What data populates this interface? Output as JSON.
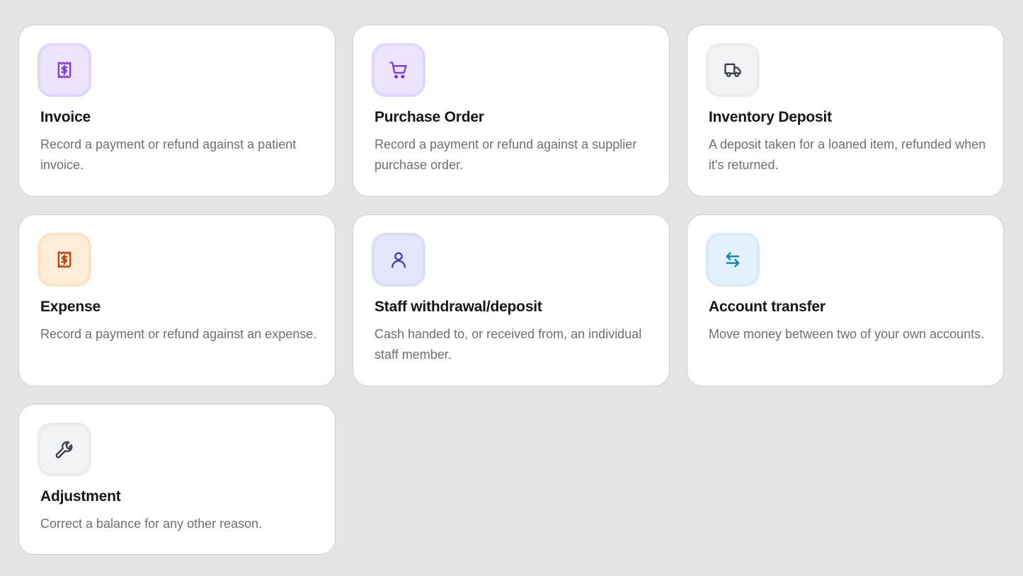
{
  "colors": {
    "purple_tile_bg": "#ede4fd",
    "purple_tile_border": "#e2d6fb",
    "purple_icon": "#7c3aed",
    "gray_tile_bg": "#f2f3f5",
    "gray_tile_border": "#ebecef",
    "gray_icon": "#3a3f4b",
    "orange_tile_bg": "#ffedd8",
    "orange_tile_border": "#fde3c6",
    "orange_icon": "#c2410c",
    "indigo_tile_bg": "#e4e6fd",
    "indigo_tile_border": "#d9dcfb",
    "indigo_icon": "#4338ca",
    "sky_tile_bg": "#e3f2fc",
    "sky_tile_border": "#d6ebf9",
    "sky_icon": "#0284c7"
  },
  "cards": [
    {
      "title": "Invoice",
      "description": "Record a payment or refund against a patient invoice.",
      "icon": "receipt-dollar-icon",
      "tone": "purple"
    },
    {
      "title": "Purchase Order",
      "description": "Record a payment or refund against a supplier purchase order.",
      "icon": "shopping-cart-icon",
      "tone": "purple"
    },
    {
      "title": "Inventory Deposit",
      "description": "A deposit taken for a loaned item, refunded when it's returned.",
      "icon": "truck-icon",
      "tone": "gray"
    },
    {
      "title": "Expense",
      "description": "Record a payment or refund against an expense.",
      "icon": "receipt-dollar-icon",
      "tone": "orange"
    },
    {
      "title": "Staff withdrawal/deposit",
      "description": "Cash handed to, or received from, an individual staff member.",
      "icon": "user-icon",
      "tone": "indigo"
    },
    {
      "title": "Account transfer",
      "description": "Move money between two of your own accounts.",
      "icon": "arrows-left-right-icon",
      "tone": "sky"
    },
    {
      "title": "Adjustment",
      "description": "Correct a balance for any other reason.",
      "icon": "wrench-icon",
      "tone": "gray"
    }
  ]
}
